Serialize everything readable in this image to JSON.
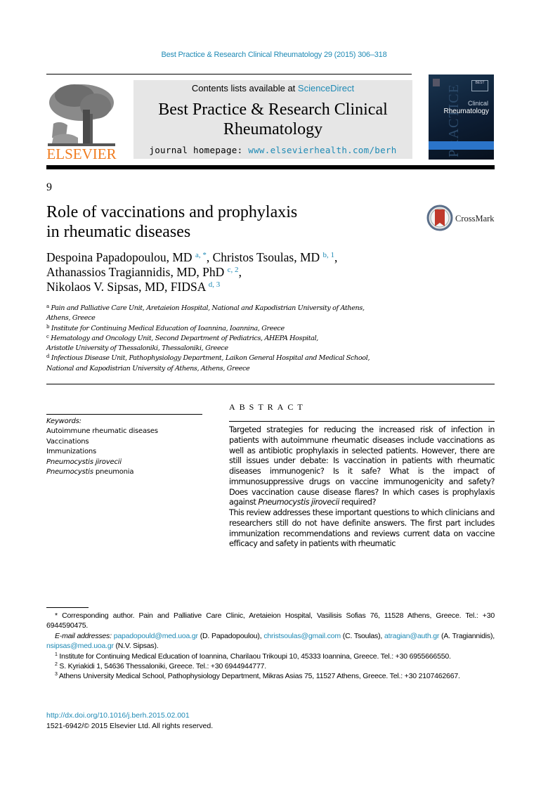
{
  "running_head": "Best Practice & Research Clinical Rheumatology 29 (2015) 306–318",
  "masthead": {
    "publisher_logo": "ELSEVIER",
    "contents_prefix": "Contents lists available at ",
    "contents_link": "ScienceDirect",
    "journal_title_line1": "Best Practice & Research Clinical",
    "journal_title_line2": "Rheumatology",
    "homepage_prefix": "journal homepage: ",
    "homepage_link": "www.elsevierhealth.com/berh",
    "cover": {
      "vertical_text": "PRACTICE",
      "tag": "BEST",
      "line1": "Clinical",
      "line2": "Rheumatology",
      "accent_color": "#2b74c9"
    }
  },
  "article": {
    "number": "9",
    "title_line1": "Role of vaccinations and prophylaxis",
    "title_line2": "in rheumatic diseases",
    "crossmark_label": "CrossMark",
    "authors": [
      {
        "name": "Despoina Papadopoulou, MD",
        "sup": "a, *",
        "sep": ", "
      },
      {
        "name": "Christos Tsoulas, MD",
        "sup": "b, 1",
        "sep": ","
      },
      {
        "name": "Athanassios Tragiannidis, MD, PhD",
        "sup": "c, 2",
        "sep": ","
      },
      {
        "name": "Nikolaos V. Sipsas, MD, FIDSA",
        "sup": "d, 3",
        "sep": ""
      }
    ],
    "affiliations": [
      {
        "mark": "a",
        "line1": "Pain and Palliative Care Unit, Aretaieion Hospital, National and Kapodistrian University of Athens,",
        "line2": "Athens, Greece"
      },
      {
        "mark": "b",
        "line1": "Institute for Continuing Medical Education of Ioannina, Ioannina, Greece",
        "line2": ""
      },
      {
        "mark": "c",
        "line1": "Hematology and Oncology Unit, Second Department of Pediatrics, AHEPA Hospital,",
        "line2": "Aristotle University of Thessaloniki, Thessaloniki, Greece"
      },
      {
        "mark": "d",
        "line1": "Infectious Disease Unit, Pathophysiology Department, Laikon General Hospital and Medical School,",
        "line2": "National and Kapodistrian University of Athens, Athens, Greece"
      }
    ]
  },
  "keywords": {
    "label": "Keywords:",
    "items": [
      {
        "italic": "",
        "text": "Autoimmune rheumatic diseases"
      },
      {
        "italic": "",
        "text": "Vaccinations"
      },
      {
        "italic": "",
        "text": "Immunizations"
      },
      {
        "italic": "Pneumocystis jirovecii",
        "text": ""
      },
      {
        "italic": "Pneumocystis",
        "text": " pneumonia"
      }
    ]
  },
  "abstract": {
    "heading": "ABSTRACT",
    "p1_a": "Targeted strategies for reducing the increased risk of infection in patients with autoimmune rheumatic diseases include vaccinations as well as antibiotic prophylaxis in selected patients. However, there are still issues under debate: Is vaccination in patients with rheumatic diseases immunogenic? Is it safe? What is the impact of immunosuppressive drugs on vaccine immunogenicity and safety? Does vaccination cause disease flares? In which cases is prophylaxis against ",
    "p1_italic": "Pneumocystis jirovecii",
    "p1_b": " required?",
    "p2": "This review addresses these important questions to which clinicians and researchers still do not have definite answers. The first part includes immunization recommendations and reviews current data on vaccine efficacy and safety in patients with rheumatic"
  },
  "footnotes": {
    "corresponding": "*  Corresponding author. Pain and Palliative Care Clinic, Aretaieion Hospital, Vasilisis Sofias 76, 11528 Athens, Greece. Tel.: +30 6944590475.",
    "email_label": "E-mail addresses: ",
    "emails": [
      {
        "addr": "papadopould@med.uoa.gr",
        "who": " (D. Papadopoulou), "
      },
      {
        "addr": "christsoulas@gmail.com",
        "who": " (C. Tsoulas), "
      },
      {
        "addr": "atragian@auth.gr",
        "who": " (A. Tragiannidis), "
      },
      {
        "addr": "nsipsas@med.uoa.gr",
        "who": " (N.V. Sipsas)."
      }
    ],
    "notes": [
      {
        "mark": "1",
        "text": "Institute for Continuing Medical Education of Ioannina, Charilaou Trikoupi 10, 45333 Ioannina, Greece. Tel.: +30 6955666550."
      },
      {
        "mark": "2",
        "text": "S. Kyriakidi 1, 54636 Thessaloniki, Greece. Tel.: +30 6944944777."
      },
      {
        "mark": "3",
        "text": "Athens University Medical School, Pathophysiology Department, Mikras Asias 75, 11527 Athens, Greece. Tel.: +30 2107462667."
      }
    ]
  },
  "doi": {
    "link": "http://dx.doi.org/10.1016/j.berh.2015.02.001",
    "copyright": "1521-6942/© 2015 Elsevier Ltd. All rights reserved."
  }
}
